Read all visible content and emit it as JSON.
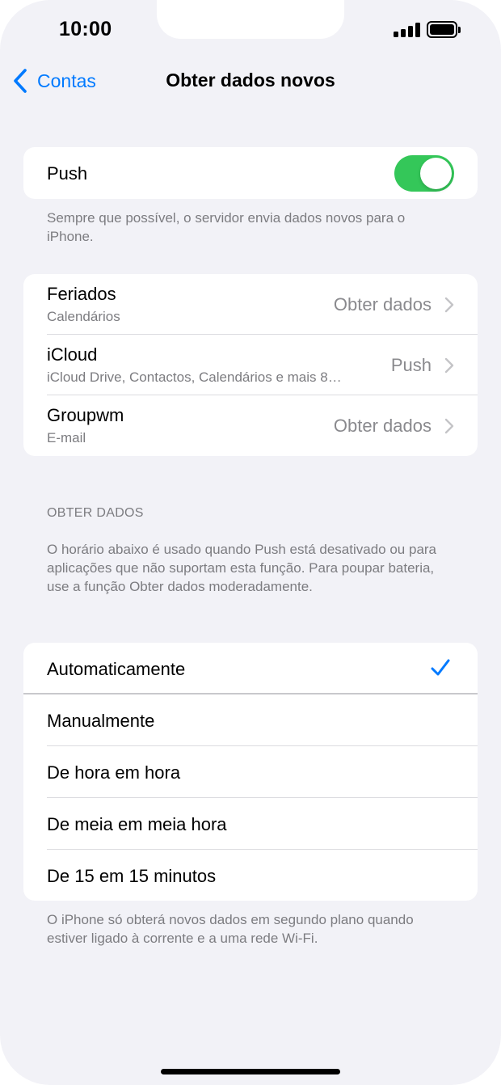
{
  "status": {
    "time": "10:00"
  },
  "nav": {
    "back_label": "Contas",
    "title": "Obter dados novos"
  },
  "push": {
    "label": "Push",
    "enabled": true,
    "footnote": "Sempre que possível, o servidor envia dados novos para o iPhone."
  },
  "accounts": [
    {
      "name": "Feriados",
      "detail": "Calendários",
      "value": "Obter dados"
    },
    {
      "name": "iCloud",
      "detail": "iCloud Drive, Contactos, Calendários e mais 8…",
      "value": "Push"
    },
    {
      "name": "Groupwm",
      "detail": "E-mail",
      "value": "Obter dados"
    }
  ],
  "fetch": {
    "header": "OBTER DADOS",
    "description": "O horário abaixo é usado quando Push está desativado ou para aplicações que não suportam esta função. Para poupar bateria, use a função Obter dados moderadamente.",
    "options": [
      {
        "label": "Automaticamente",
        "selected": true
      },
      {
        "label": "Manualmente",
        "selected": false
      },
      {
        "label": "De hora em hora",
        "selected": false
      },
      {
        "label": "De meia em meia hora",
        "selected": false
      },
      {
        "label": "De 15 em 15 minutos",
        "selected": false
      }
    ],
    "footnote": "O iPhone só obterá novos dados em segundo plano quando estiver ligado à corrente e a uma rede Wi-Fi."
  },
  "colors": {
    "accent": "#007aff",
    "toggle_on": "#34c759",
    "background": "#f2f2f7",
    "secondary_text": "#8a8a8e"
  },
  "icons": {
    "back": "chevron-left-icon",
    "disclosure": "chevron-right-icon",
    "selected": "checkmark-icon",
    "signal": "cellular-signal-icon",
    "battery": "battery-icon"
  }
}
